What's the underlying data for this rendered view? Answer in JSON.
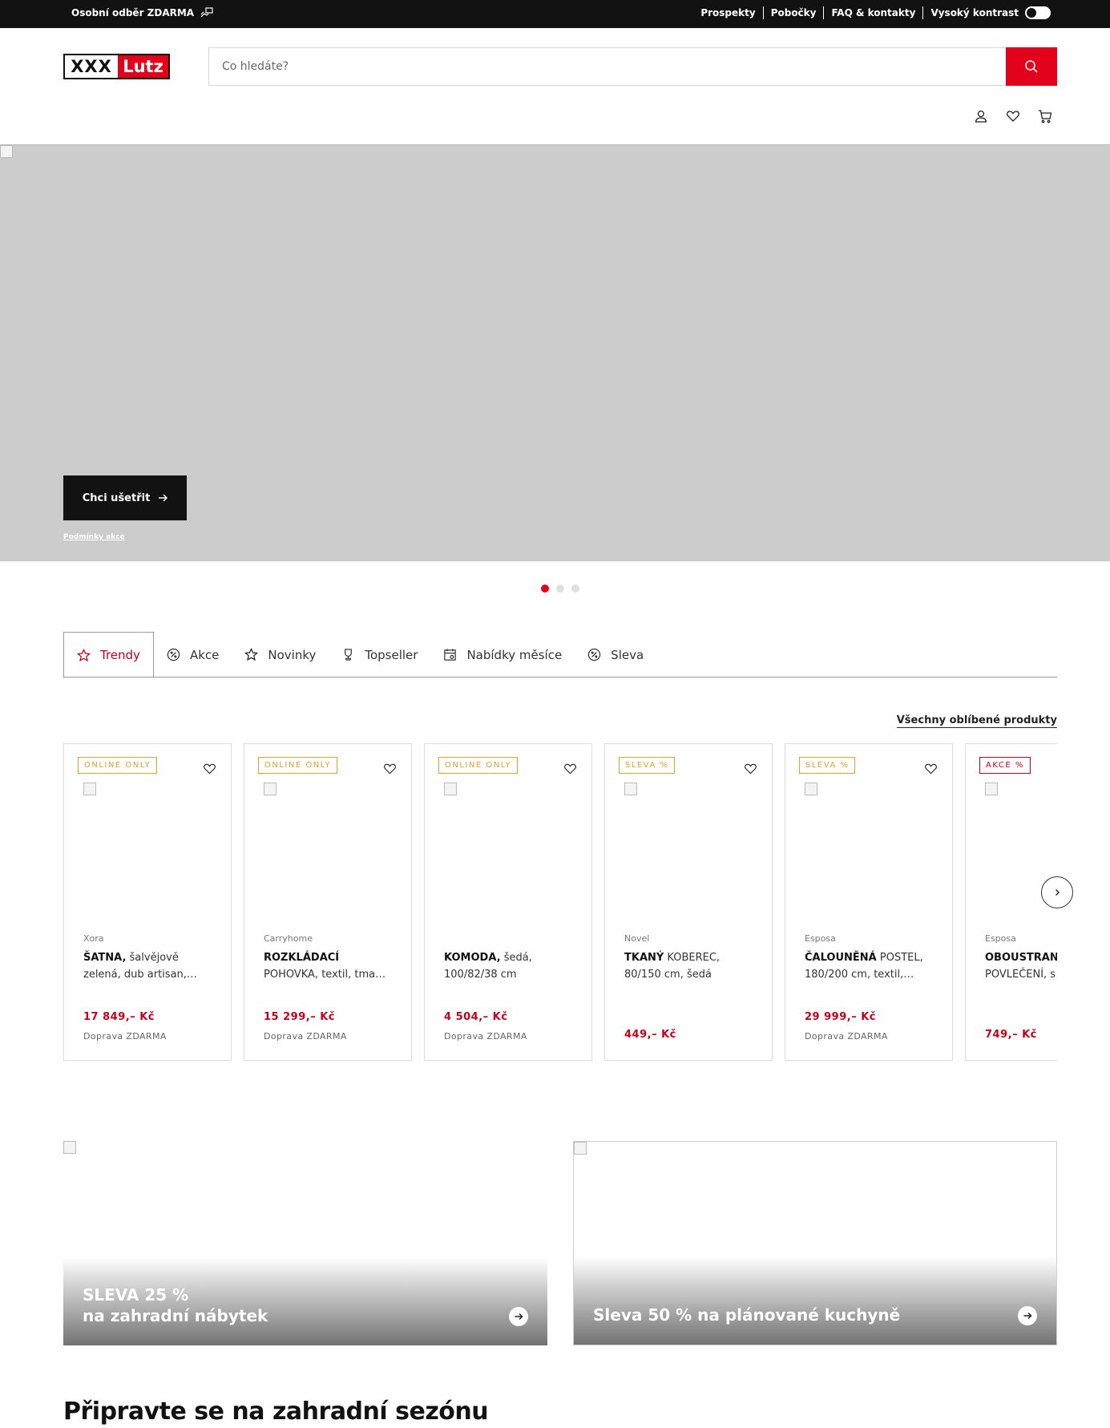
{
  "topbar": {
    "pickup_label": "Osobní odběr ZDARMA",
    "links": [
      "Prospekty",
      "Pobočky",
      "FAQ & kontakty",
      "Vysoký kontrast"
    ]
  },
  "header": {
    "logo_left": "XXX",
    "logo_right": "Lutz",
    "search_placeholder": "Co hledáte?",
    "icons": [
      "user-icon",
      "heart-icon",
      "cart-icon"
    ]
  },
  "hero": {
    "cta_label": "Chci ušetřit",
    "terms_label": "Podmínky akce",
    "slides": 3,
    "active_slide": 1
  },
  "tabs": [
    {
      "label": "Trendy",
      "icon": "star-icon",
      "active": true
    },
    {
      "label": "Akce",
      "icon": "percent-icon",
      "active": false
    },
    {
      "label": "Novinky",
      "icon": "star-icon",
      "active": false
    },
    {
      "label": "Topseller",
      "icon": "trophy-icon",
      "active": false
    },
    {
      "label": "Nabídky měsíce",
      "icon": "calendar-icon",
      "active": false
    },
    {
      "label": "Sleva",
      "icon": "percent-icon",
      "active": false
    }
  ],
  "all_favorites_label": "Všechny oblíbené produkty",
  "products": [
    {
      "badge": "ONLINE ONLY",
      "brand": "Xora",
      "name_bold": "ŠATNA,",
      "name_line1": " šalvějově",
      "name_line2": "zelená, dub artisan,…",
      "price": "17 849,– Kč",
      "shipping": "Doprava ZDARMA"
    },
    {
      "badge": "ONLINE ONLY",
      "brand": "Carryhome",
      "name_bold": "ROZKLÁDACÍ",
      "name_line1": "",
      "name_line2": "POHOVKA, textil, tma…",
      "price": "15 299,– Kč",
      "shipping": "Doprava ZDARMA"
    },
    {
      "badge": "ONLINE ONLY",
      "brand": "",
      "name_bold": "KOMODA,",
      "name_line1": " šedá,",
      "name_line2": "100/82/38 cm",
      "price": "4 504,– Kč",
      "shipping": "Doprava ZDARMA"
    },
    {
      "badge": "SLEVA %",
      "brand": "Novel",
      "name_bold": "TKANÝ",
      "name_line1": " KOBEREC,",
      "name_line2": "80/150 cm, šedá",
      "price": "449,– Kč",
      "shipping": ""
    },
    {
      "badge": "SLEVA %",
      "brand": "Esposa",
      "name_bold": "ČALOUNĚNÁ",
      "name_line1": " POSTEL,",
      "name_line2": "180/200 cm, textil,…",
      "price": "29 999,– Kč",
      "shipping": "Doprava ZDARMA"
    },
    {
      "badge": "AKCE %",
      "brand": "Esposa",
      "name_bold": "OBOUSTRAN",
      "name_line1": "",
      "name_line2": "POVLEČENÍ, s",
      "price": "749,– Kč",
      "shipping": ""
    }
  ],
  "promos": [
    {
      "line1": "SLEVA 25 %",
      "line2": "na zahradní nábytek"
    },
    {
      "line1": "",
      "line2": "Sleva 50 % na plánované kuchyně"
    }
  ],
  "section_title": "Připravte se na zahradní sezónu",
  "colors": {
    "accent": "#e2001a",
    "price": "#c4001a",
    "badge_online": "#e0a22e",
    "dark": "#121212"
  }
}
